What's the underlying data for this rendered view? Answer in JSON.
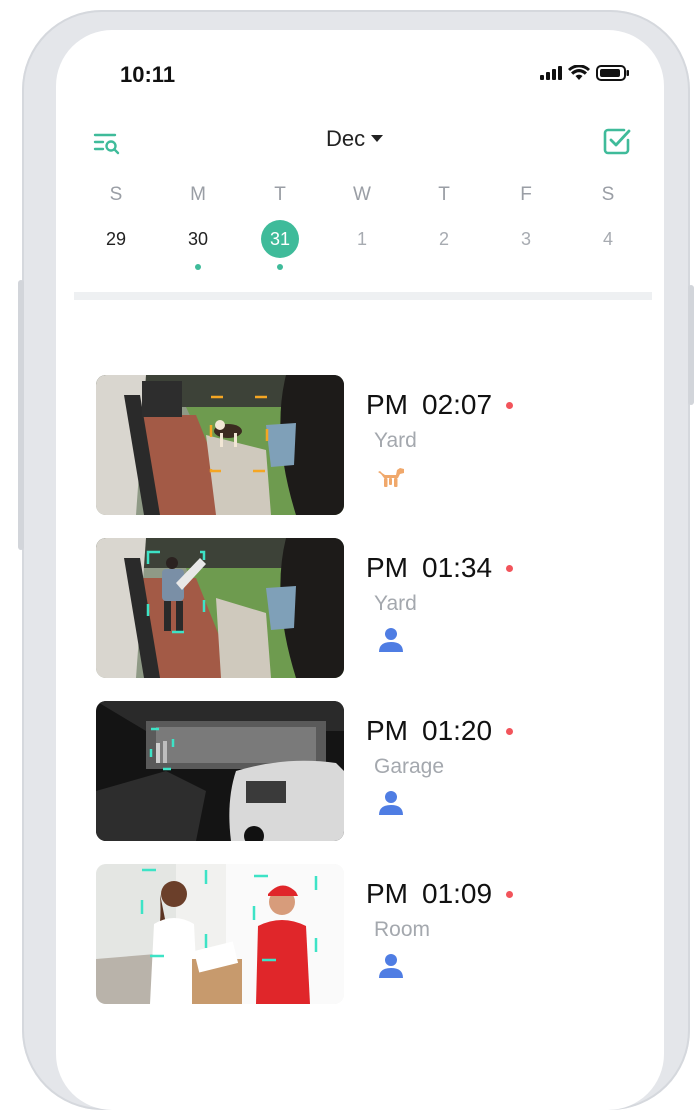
{
  "status_bar": {
    "time": "10:11"
  },
  "header": {
    "month": "Dec"
  },
  "week": {
    "days": [
      {
        "dow": "S",
        "date": "29",
        "state": "past",
        "has_events": false
      },
      {
        "dow": "M",
        "date": "30",
        "state": "past",
        "has_events": true
      },
      {
        "dow": "T",
        "date": "31",
        "state": "selected",
        "has_events": true
      },
      {
        "dow": "W",
        "date": "1",
        "state": "future",
        "has_events": false
      },
      {
        "dow": "T",
        "date": "2",
        "state": "future",
        "has_events": false
      },
      {
        "dow": "F",
        "date": "3",
        "state": "future",
        "has_events": false
      },
      {
        "dow": "S",
        "date": "4",
        "state": "future",
        "has_events": false
      }
    ]
  },
  "events": [
    {
      "period": "PM",
      "time": "02:07",
      "location": "Yard",
      "type": "pet",
      "icon": "dog-icon"
    },
    {
      "period": "PM",
      "time": "01:34",
      "location": "Yard",
      "type": "person",
      "icon": "person-icon"
    },
    {
      "period": "PM",
      "time": "01:20",
      "location": "Garage",
      "type": "person",
      "icon": "person-icon"
    },
    {
      "period": "PM",
      "time": "01:09",
      "location": "Room",
      "type": "person",
      "icon": "person-icon"
    }
  ],
  "colors": {
    "accent": "#3fbb9a",
    "unread_dot": "#f2545b",
    "pet": "#f0a86b",
    "person": "#4f7de3",
    "pet_box": "#f5a623",
    "person_box": "#3de3c6"
  }
}
